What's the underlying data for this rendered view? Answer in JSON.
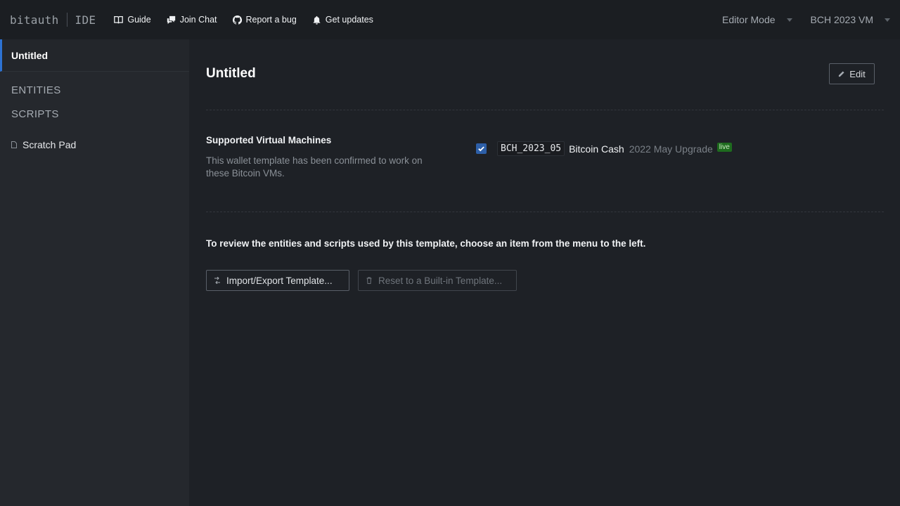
{
  "brand": {
    "name": "bitauth",
    "suffix": "IDE"
  },
  "nav": [
    {
      "label": "Guide",
      "icon": "book-icon"
    },
    {
      "label": "Join Chat",
      "icon": "chat-icon"
    },
    {
      "label": "Report a bug",
      "icon": "github-icon"
    },
    {
      "label": "Get updates",
      "icon": "bell-icon"
    }
  ],
  "selects": {
    "mode": "Editor Mode",
    "vm": "BCH 2023 VM"
  },
  "sidebar": {
    "title": "Untitled",
    "entities_label": "ENTITIES",
    "scripts_label": "SCRIPTS",
    "files": [
      {
        "label": "Scratch Pad",
        "icon": "file-icon"
      }
    ]
  },
  "main": {
    "title": "Untitled",
    "edit_label": "Edit",
    "vm_heading": "Supported Virtual Machines",
    "vm_description": "This wallet template has been confirmed to work on these Bitcoin VMs.",
    "vm": {
      "checked": true,
      "code": "BCH_2023_05",
      "name": "Bitcoin Cash",
      "upgrade": "2022 May Upgrade",
      "badge": "live"
    },
    "review_text": "To review the entities and scripts used by this template, choose an item from the menu to the left.",
    "import_label": "Import/Export Template...",
    "reset_label": "Reset to a Built-in Template..."
  },
  "colors": {
    "accent": "#2d72d2",
    "checkbox": "#2d5fa8",
    "live_badge": "#1e6b1e",
    "background": "#1e2126",
    "sidebar": "#25282d"
  }
}
